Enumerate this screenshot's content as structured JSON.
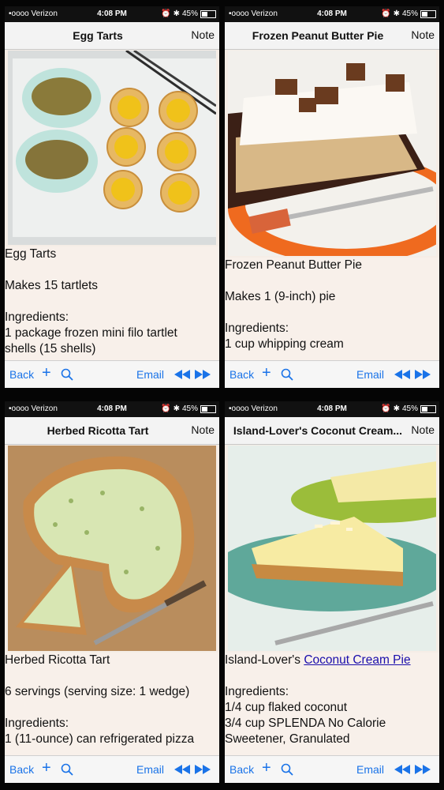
{
  "status_bar": {
    "carrier": "•oooo Verizon",
    "time": "4:08 PM",
    "battery": "45%"
  },
  "common": {
    "note_label": "Note",
    "back_label": "Back",
    "plus_label": "+",
    "email_label": "Email"
  },
  "screens": [
    {
      "title": "Egg Tarts",
      "lines": [
        "Egg Tarts",
        "",
        "Makes 15 tartlets",
        "",
        "Ingredients:",
        "1 package frozen mini filo tartlet",
        "shells (15 shells)"
      ]
    },
    {
      "title": "Frozen Peanut Butter Pie",
      "lines": [
        "Frozen Peanut Butter Pie",
        "",
        "Makes 1 (9-inch) pie",
        "",
        "Ingredients:",
        "1 cup whipping cream"
      ]
    },
    {
      "title": "Herbed Ricotta Tart",
      "lines": [
        "Herbed Ricotta Tart",
        "",
        "6 servings (serving size: 1 wedge)",
        "",
        "Ingredients:",
        "1 (11-ounce) can refrigerated pizza"
      ]
    },
    {
      "title": "Island-Lover's Coconut Cream...",
      "line0_prefix": "Island-Lover's ",
      "line0_link": "Coconut Cream Pie",
      "lines": [
        "",
        "",
        "Ingredients:",
        "1/4 cup flaked coconut",
        "3/4 cup SPLENDA No Calorie",
        "Sweetener, Granulated"
      ]
    }
  ]
}
